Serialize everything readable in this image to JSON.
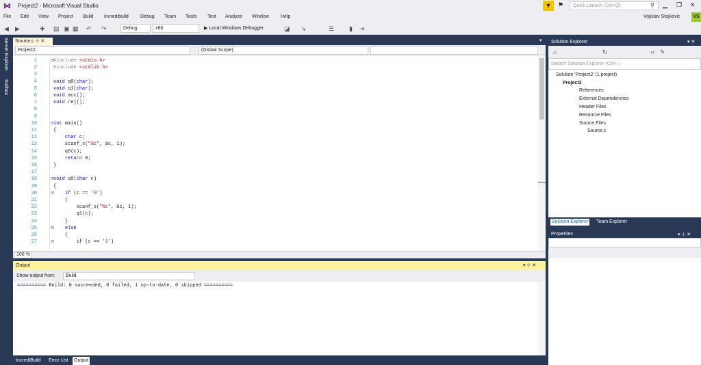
{
  "window": {
    "title": "Project2 - Microsoft Visual Studio",
    "quick_launch_placeholder": "Quick Launch (Ctrl+Q)",
    "user": "Vojislav Stojkovic",
    "user_initials": "VS"
  },
  "menu": [
    "File",
    "Edit",
    "View",
    "Project",
    "Build",
    "Incredibuild",
    "Debug",
    "Team",
    "Tools",
    "Test",
    "Analyze",
    "Window",
    "Help"
  ],
  "toolbar": {
    "config": "Debug",
    "platform": "x86",
    "debugger": "▶ Local Windows Debugger"
  },
  "sidebar": {
    "server_explorer": "Server Explorer",
    "toolbox": "Toolbox"
  },
  "editor": {
    "tab_label": "Source.c",
    "nav_project": "Project2",
    "nav_scope": "(Global Scope)",
    "zoom": "100 %",
    "lines": [
      {
        "n": "1",
        "t": "#include <stdio.h>"
      },
      {
        "n": "2",
        "t": "#include <stdlib.h>"
      },
      {
        "n": "3",
        "t": ""
      },
      {
        "n": "4",
        "t": "void q0(char);"
      },
      {
        "n": "5",
        "t": "void q1(char);"
      },
      {
        "n": "6",
        "t": "void acc();"
      },
      {
        "n": "7",
        "t": "void rej();"
      },
      {
        "n": "8",
        "t": ""
      },
      {
        "n": "9",
        "t": ""
      },
      {
        "n": "10",
        "t": "int main()"
      },
      {
        "n": "11",
        "t": "{"
      },
      {
        "n": "12",
        "t": "    char c;"
      },
      {
        "n": "13",
        "t": "    scanf_s(\"%c\", &c, 1);"
      },
      {
        "n": "14",
        "t": "    q0(c);"
      },
      {
        "n": "15",
        "t": "    return 0;"
      },
      {
        "n": "16",
        "t": "}"
      },
      {
        "n": "17",
        "t": ""
      },
      {
        "n": "18",
        "t": "void q0(char c)"
      },
      {
        "n": "19",
        "t": "{"
      },
      {
        "n": "20",
        "t": "    if (c == '0')"
      },
      {
        "n": "21",
        "t": "    {"
      },
      {
        "n": "22",
        "t": "        scanf_s(\"%c\", &c, 1);"
      },
      {
        "n": "23",
        "t": "        q1(c);"
      },
      {
        "n": "24",
        "t": "    }"
      },
      {
        "n": "25",
        "t": "    else"
      },
      {
        "n": "26",
        "t": "    {"
      },
      {
        "n": "27",
        "t": "        if (c == '1')"
      }
    ]
  },
  "output": {
    "title": "Output",
    "show_from_label": "Show output from:",
    "source": "Build",
    "text": "========== Build: 0 succeeded, 0 failed, 1 up-to-date, 0 skipped =========="
  },
  "bottom_tabs": [
    "IncrediBuild",
    "Error List",
    "Output"
  ],
  "solution_explorer": {
    "title": "Solution Explorer",
    "search_placeholder": "Search Solution Explorer (Ctrl+;)",
    "items": [
      {
        "label": "Solution 'Project2' (1 project)"
      },
      {
        "label": "Project2"
      },
      {
        "label": "References"
      },
      {
        "label": "External Dependencies"
      },
      {
        "label": "Header Files"
      },
      {
        "label": "Resource Files"
      },
      {
        "label": "Source Files"
      },
      {
        "label": "Source.c"
      }
    ],
    "tabs": [
      "Solution Explorer",
      "Team Explorer"
    ]
  },
  "properties": {
    "title": "Properties"
  }
}
